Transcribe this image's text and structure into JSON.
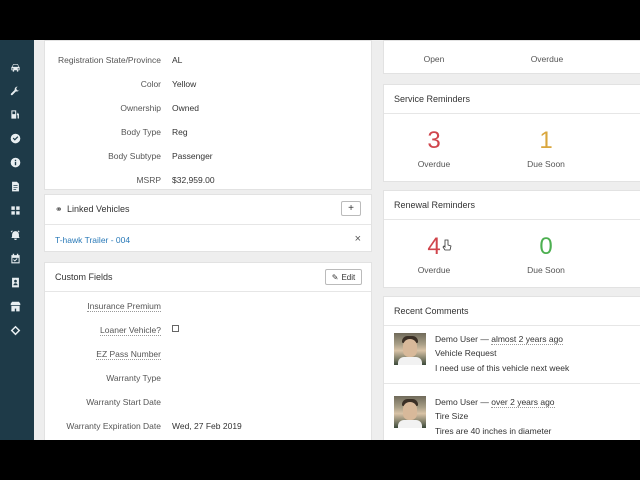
{
  "sidebar": {
    "icons": [
      "car-icon",
      "wrench-icon",
      "fuel-icon",
      "check-circle-icon",
      "info-icon",
      "document-icon",
      "grid-icon",
      "alarm-icon",
      "calendar-icon",
      "contact-icon",
      "shop-icon",
      "waypoint-icon"
    ]
  },
  "details": {
    "rows": [
      {
        "label": "Registration State/Province",
        "value": "AL"
      },
      {
        "label": "Color",
        "value": "Yellow"
      },
      {
        "label": "Ownership",
        "value": "Owned"
      },
      {
        "label": "Body Type",
        "value": "Reg"
      },
      {
        "label": "Body Subtype",
        "value": "Passenger"
      },
      {
        "label": "MSRP",
        "value": "$32,959.00"
      }
    ]
  },
  "linked": {
    "title": "Linked Vehicles",
    "add_label": "+",
    "item": "T-hawk Trailer - 004",
    "remove_label": "×"
  },
  "custom": {
    "title": "Custom Fields",
    "edit_label": "Edit",
    "rows": [
      {
        "label": "Insurance Premium",
        "value": ""
      },
      {
        "label": "Loaner Vehicle?",
        "value": ""
      },
      {
        "label": "EZ Pass Number",
        "value": ""
      },
      {
        "label": "Warranty Type",
        "value": ""
      },
      {
        "label": "Warranty Start Date",
        "value": ""
      },
      {
        "label": "Warranty Expiration Date",
        "value": "Wed, 27 Feb 2019"
      }
    ]
  },
  "top_partial": {
    "open_label": "Open",
    "overdue_label": "Overdue"
  },
  "service": {
    "title": "Service Reminders",
    "overdue_value": "3",
    "overdue_label": "Overdue",
    "due_soon_value": "1",
    "due_soon_label": "Due Soon"
  },
  "renewal": {
    "title": "Renewal Reminders",
    "overdue_value": "4",
    "overdue_label": "Overdue",
    "due_soon_value": "0",
    "due_soon_label": "Due Soon"
  },
  "comments": {
    "title": "Recent Comments",
    "items": [
      {
        "user": "Demo User",
        "time": "almost 2 years ago",
        "subject": "Vehicle Request",
        "body": "I need use of this vehicle next week"
      },
      {
        "user": "Demo User",
        "time": "over 2 years ago",
        "subject": "Tire Size",
        "body": "Tires are 40 inches in diameter"
      }
    ]
  },
  "colors": {
    "sidebar": "#1e3a48",
    "overdue": "#d0454c",
    "due_soon": "#d9a63d",
    "ok": "#4caf50",
    "link": "#2a7ab8"
  }
}
